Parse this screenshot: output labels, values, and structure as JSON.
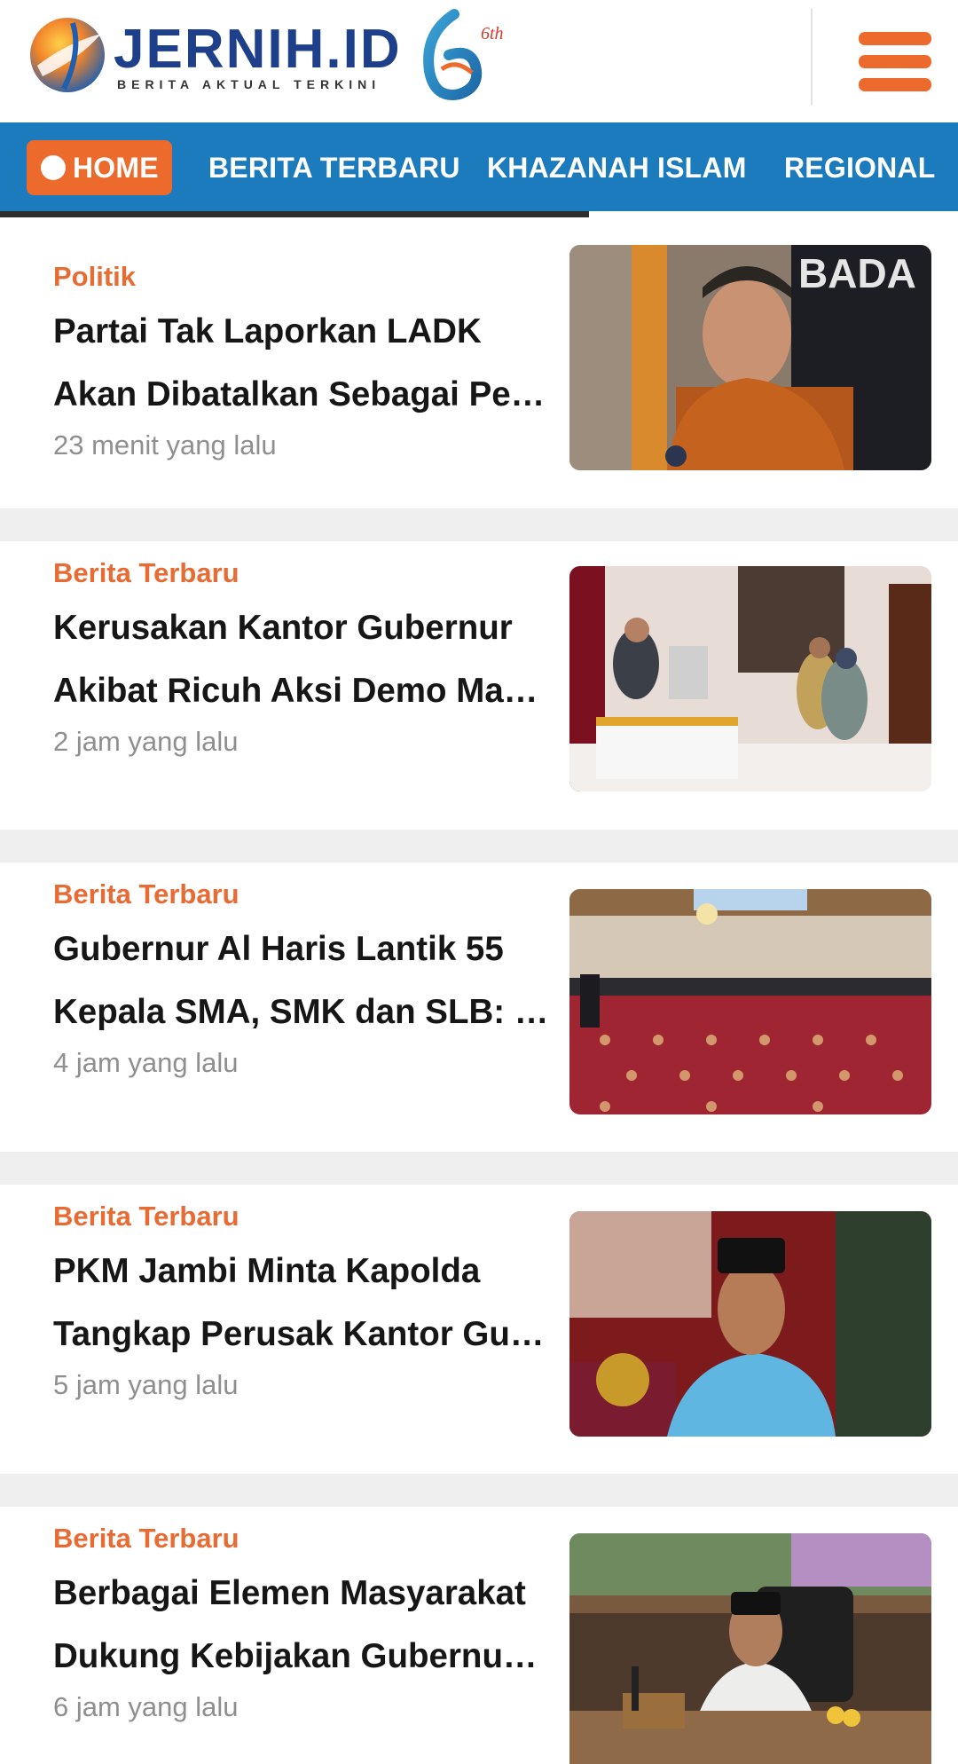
{
  "header": {
    "logo_text": "JERNIH.ID",
    "logo_tagline": "BERITA AKTUAL TERKINI",
    "logo_badge": "6th",
    "menu_icon": "hamburger-menu-icon"
  },
  "nav": {
    "items": [
      {
        "label": "HOME",
        "active": true
      },
      {
        "label": "BERITA TERBARU"
      },
      {
        "label": "KHAZANAH ISLAM"
      },
      {
        "label": "REGIONAL"
      }
    ]
  },
  "colors": {
    "accent": "#ec6a2b",
    "nav_bg": "#1b7bbd",
    "category": "#e76b33",
    "meta": "#8f8f8f"
  },
  "articles": [
    {
      "category": "Politik",
      "title_line1": "Partai Tak Laporkan LADK",
      "title_line2": "Akan Dibatalkan Sebagai Peserta Pemilu",
      "time": "23 menit yang lalu",
      "image": "man in batik shirt speaking to reporters"
    },
    {
      "category": "Berita Terbaru",
      "title_line1": "Kerusakan Kantor Gubernur",
      "title_line2": "Akibat Ricuh Aksi Demo Mahasiswa",
      "time": "2 jam yang lalu",
      "image": "officials inspecting a damaged office desk"
    },
    {
      "category": "Berita Terbaru",
      "title_line1": "Gubernur Al Haris Lantik 55",
      "title_line2": "Kepala SMA, SMK dan SLB: Harus Amanah",
      "time": "4 jam yang lalu",
      "image": "inauguration ceremony in a hall with red carpet"
    },
    {
      "category": "Berita Terbaru",
      "title_line1": "PKM Jambi Minta Kapolda",
      "title_line2": "Tangkap Perusak Kantor Gubernur",
      "time": "5 jam yang lalu",
      "image": "man in blue shirt and black cap"
    },
    {
      "category": "Berita Terbaru",
      "title_line1": "Berbagai Elemen Masyarakat",
      "title_line2": "Dukung Kebijakan Gubernur Jambi",
      "time": "6 jam yang lalu",
      "image": "official speaking at a meeting table"
    }
  ]
}
